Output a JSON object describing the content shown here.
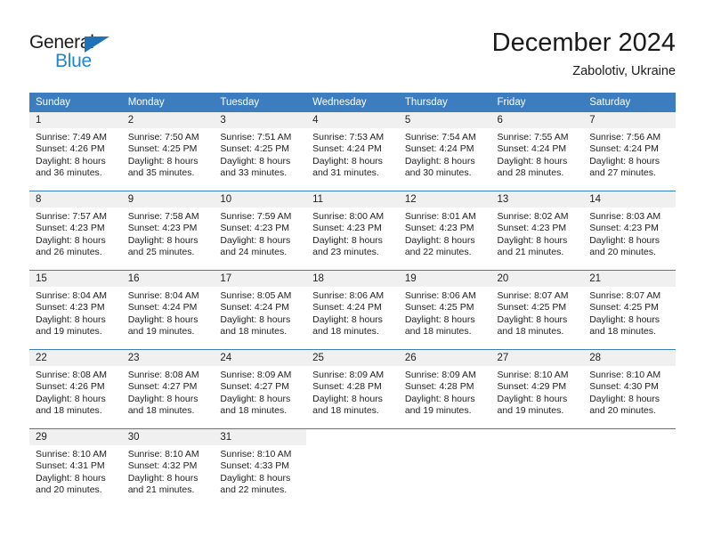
{
  "logo": {
    "word_top": "General",
    "word_bottom": "Blue",
    "triangle_color": "#1f72b8",
    "blue_text_color": "#1f86d0",
    "icon": "general-blue-logo"
  },
  "header": {
    "month_title": "December 2024",
    "location": "Zabolotiv, Ukraine"
  },
  "theme": {
    "header_blue": "#3b7dbf",
    "daynum_band": "#f0f0f0",
    "text": "#222222"
  },
  "calendar": {
    "weekday_headers": [
      "Sunday",
      "Monday",
      "Tuesday",
      "Wednesday",
      "Thursday",
      "Friday",
      "Saturday"
    ],
    "weeks": [
      [
        {
          "day": "1",
          "sunrise": "Sunrise: 7:49 AM",
          "sunset": "Sunset: 4:26 PM",
          "daylight_line1": "Daylight: 8 hours",
          "daylight_line2": "and 36 minutes."
        },
        {
          "day": "2",
          "sunrise": "Sunrise: 7:50 AM",
          "sunset": "Sunset: 4:25 PM",
          "daylight_line1": "Daylight: 8 hours",
          "daylight_line2": "and 35 minutes."
        },
        {
          "day": "3",
          "sunrise": "Sunrise: 7:51 AM",
          "sunset": "Sunset: 4:25 PM",
          "daylight_line1": "Daylight: 8 hours",
          "daylight_line2": "and 33 minutes."
        },
        {
          "day": "4",
          "sunrise": "Sunrise: 7:53 AM",
          "sunset": "Sunset: 4:24 PM",
          "daylight_line1": "Daylight: 8 hours",
          "daylight_line2": "and 31 minutes."
        },
        {
          "day": "5",
          "sunrise": "Sunrise: 7:54 AM",
          "sunset": "Sunset: 4:24 PM",
          "daylight_line1": "Daylight: 8 hours",
          "daylight_line2": "and 30 minutes."
        },
        {
          "day": "6",
          "sunrise": "Sunrise: 7:55 AM",
          "sunset": "Sunset: 4:24 PM",
          "daylight_line1": "Daylight: 8 hours",
          "daylight_line2": "and 28 minutes."
        },
        {
          "day": "7",
          "sunrise": "Sunrise: 7:56 AM",
          "sunset": "Sunset: 4:24 PM",
          "daylight_line1": "Daylight: 8 hours",
          "daylight_line2": "and 27 minutes."
        }
      ],
      [
        {
          "day": "8",
          "sunrise": "Sunrise: 7:57 AM",
          "sunset": "Sunset: 4:23 PM",
          "daylight_line1": "Daylight: 8 hours",
          "daylight_line2": "and 26 minutes."
        },
        {
          "day": "9",
          "sunrise": "Sunrise: 7:58 AM",
          "sunset": "Sunset: 4:23 PM",
          "daylight_line1": "Daylight: 8 hours",
          "daylight_line2": "and 25 minutes."
        },
        {
          "day": "10",
          "sunrise": "Sunrise: 7:59 AM",
          "sunset": "Sunset: 4:23 PM",
          "daylight_line1": "Daylight: 8 hours",
          "daylight_line2": "and 24 minutes."
        },
        {
          "day": "11",
          "sunrise": "Sunrise: 8:00 AM",
          "sunset": "Sunset: 4:23 PM",
          "daylight_line1": "Daylight: 8 hours",
          "daylight_line2": "and 23 minutes."
        },
        {
          "day": "12",
          "sunrise": "Sunrise: 8:01 AM",
          "sunset": "Sunset: 4:23 PM",
          "daylight_line1": "Daylight: 8 hours",
          "daylight_line2": "and 22 minutes."
        },
        {
          "day": "13",
          "sunrise": "Sunrise: 8:02 AM",
          "sunset": "Sunset: 4:23 PM",
          "daylight_line1": "Daylight: 8 hours",
          "daylight_line2": "and 21 minutes."
        },
        {
          "day": "14",
          "sunrise": "Sunrise: 8:03 AM",
          "sunset": "Sunset: 4:23 PM",
          "daylight_line1": "Daylight: 8 hours",
          "daylight_line2": "and 20 minutes."
        }
      ],
      [
        {
          "day": "15",
          "sunrise": "Sunrise: 8:04 AM",
          "sunset": "Sunset: 4:23 PM",
          "daylight_line1": "Daylight: 8 hours",
          "daylight_line2": "and 19 minutes."
        },
        {
          "day": "16",
          "sunrise": "Sunrise: 8:04 AM",
          "sunset": "Sunset: 4:24 PM",
          "daylight_line1": "Daylight: 8 hours",
          "daylight_line2": "and 19 minutes."
        },
        {
          "day": "17",
          "sunrise": "Sunrise: 8:05 AM",
          "sunset": "Sunset: 4:24 PM",
          "daylight_line1": "Daylight: 8 hours",
          "daylight_line2": "and 18 minutes."
        },
        {
          "day": "18",
          "sunrise": "Sunrise: 8:06 AM",
          "sunset": "Sunset: 4:24 PM",
          "daylight_line1": "Daylight: 8 hours",
          "daylight_line2": "and 18 minutes."
        },
        {
          "day": "19",
          "sunrise": "Sunrise: 8:06 AM",
          "sunset": "Sunset: 4:25 PM",
          "daylight_line1": "Daylight: 8 hours",
          "daylight_line2": "and 18 minutes."
        },
        {
          "day": "20",
          "sunrise": "Sunrise: 8:07 AM",
          "sunset": "Sunset: 4:25 PM",
          "daylight_line1": "Daylight: 8 hours",
          "daylight_line2": "and 18 minutes."
        },
        {
          "day": "21",
          "sunrise": "Sunrise: 8:07 AM",
          "sunset": "Sunset: 4:25 PM",
          "daylight_line1": "Daylight: 8 hours",
          "daylight_line2": "and 18 minutes."
        }
      ],
      [
        {
          "day": "22",
          "sunrise": "Sunrise: 8:08 AM",
          "sunset": "Sunset: 4:26 PM",
          "daylight_line1": "Daylight: 8 hours",
          "daylight_line2": "and 18 minutes."
        },
        {
          "day": "23",
          "sunrise": "Sunrise: 8:08 AM",
          "sunset": "Sunset: 4:27 PM",
          "daylight_line1": "Daylight: 8 hours",
          "daylight_line2": "and 18 minutes."
        },
        {
          "day": "24",
          "sunrise": "Sunrise: 8:09 AM",
          "sunset": "Sunset: 4:27 PM",
          "daylight_line1": "Daylight: 8 hours",
          "daylight_line2": "and 18 minutes."
        },
        {
          "day": "25",
          "sunrise": "Sunrise: 8:09 AM",
          "sunset": "Sunset: 4:28 PM",
          "daylight_line1": "Daylight: 8 hours",
          "daylight_line2": "and 18 minutes."
        },
        {
          "day": "26",
          "sunrise": "Sunrise: 8:09 AM",
          "sunset": "Sunset: 4:28 PM",
          "daylight_line1": "Daylight: 8 hours",
          "daylight_line2": "and 19 minutes."
        },
        {
          "day": "27",
          "sunrise": "Sunrise: 8:10 AM",
          "sunset": "Sunset: 4:29 PM",
          "daylight_line1": "Daylight: 8 hours",
          "daylight_line2": "and 19 minutes."
        },
        {
          "day": "28",
          "sunrise": "Sunrise: 8:10 AM",
          "sunset": "Sunset: 4:30 PM",
          "daylight_line1": "Daylight: 8 hours",
          "daylight_line2": "and 20 minutes."
        }
      ],
      [
        {
          "day": "29",
          "sunrise": "Sunrise: 8:10 AM",
          "sunset": "Sunset: 4:31 PM",
          "daylight_line1": "Daylight: 8 hours",
          "daylight_line2": "and 20 minutes."
        },
        {
          "day": "30",
          "sunrise": "Sunrise: 8:10 AM",
          "sunset": "Sunset: 4:32 PM",
          "daylight_line1": "Daylight: 8 hours",
          "daylight_line2": "and 21 minutes."
        },
        {
          "day": "31",
          "sunrise": "Sunrise: 8:10 AM",
          "sunset": "Sunset: 4:33 PM",
          "daylight_line1": "Daylight: 8 hours",
          "daylight_line2": "and 22 minutes."
        },
        {
          "day": "",
          "sunrise": "",
          "sunset": "",
          "daylight_line1": "",
          "daylight_line2": ""
        },
        {
          "day": "",
          "sunrise": "",
          "sunset": "",
          "daylight_line1": "",
          "daylight_line2": ""
        },
        {
          "day": "",
          "sunrise": "",
          "sunset": "",
          "daylight_line1": "",
          "daylight_line2": ""
        },
        {
          "day": "",
          "sunrise": "",
          "sunset": "",
          "daylight_line1": "",
          "daylight_line2": ""
        }
      ]
    ]
  }
}
